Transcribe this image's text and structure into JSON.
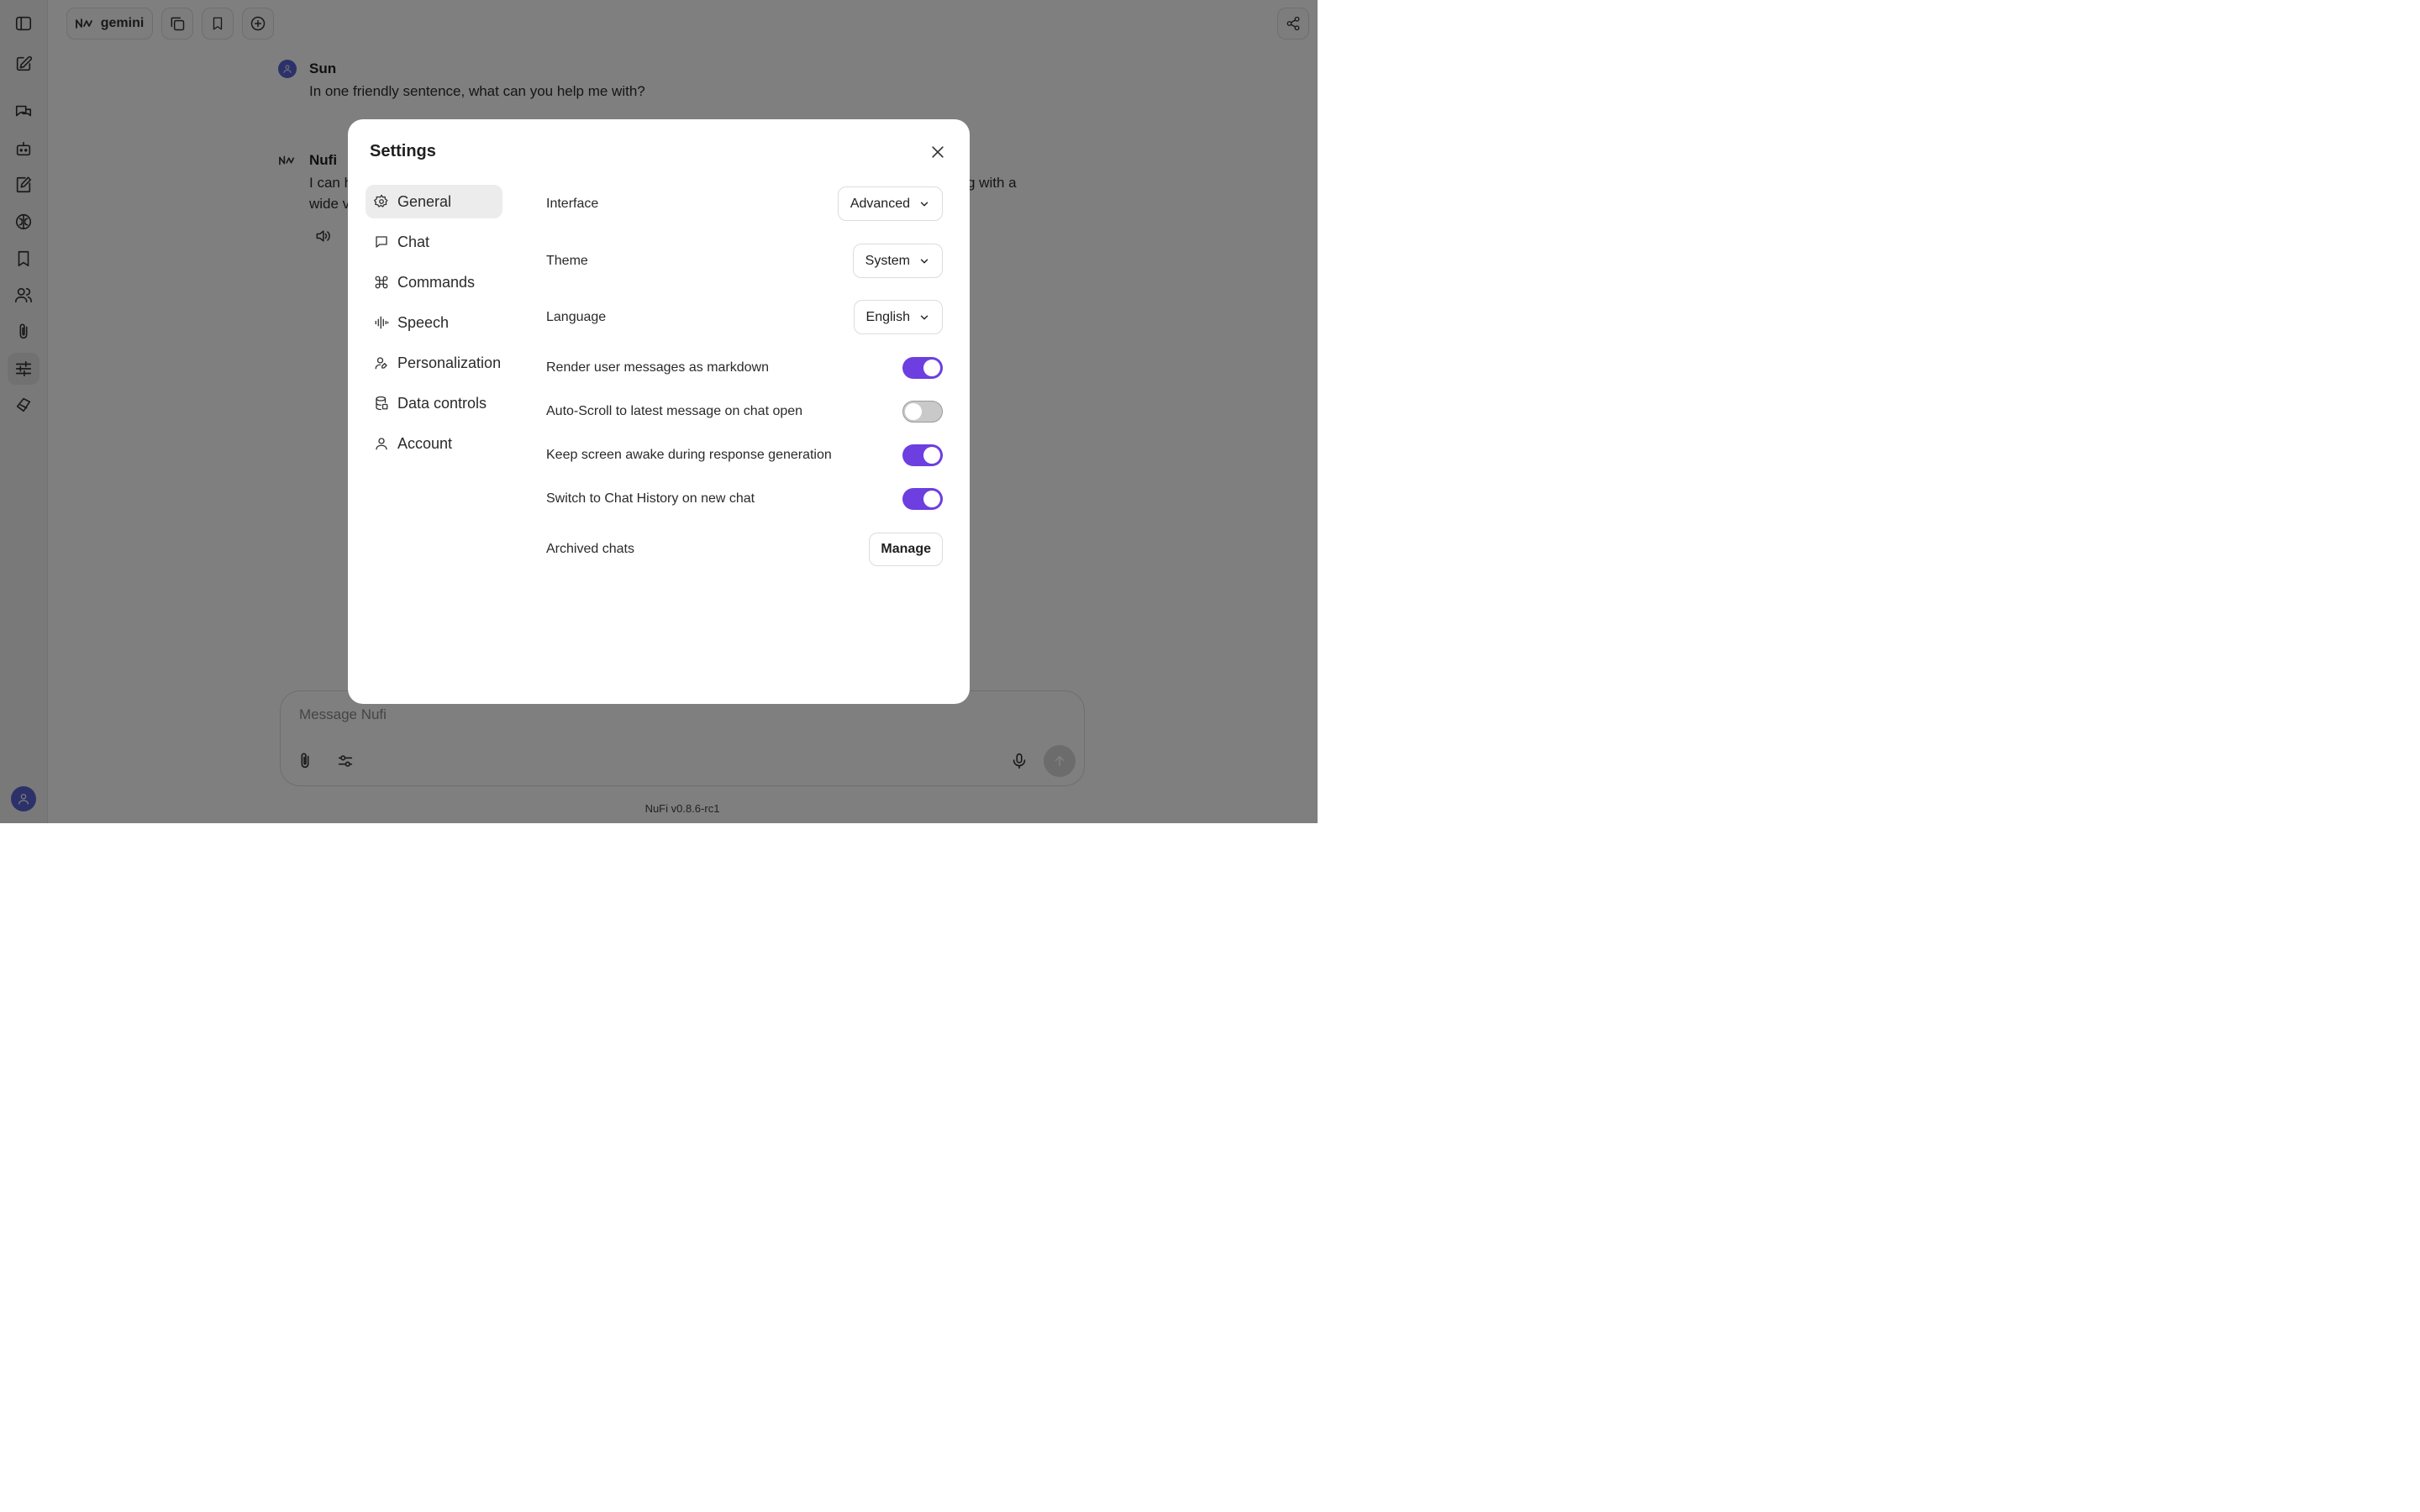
{
  "header": {
    "model_name": "gemini"
  },
  "conversation": {
    "user": {
      "name": "Sun",
      "text": "In one friendly sentence, what can you help me with?"
    },
    "assistant": {
      "name": "Nufi",
      "text_line1": "I can h",
      "text_line1_tail": "g with a",
      "text_line2": "wide v"
    }
  },
  "composer": {
    "placeholder": "Message Nufi"
  },
  "footer": {
    "version": "NuFi v0.8.6-rc1"
  },
  "settings_modal": {
    "title": "Settings",
    "nav": [
      {
        "label": "General",
        "icon": "gear-icon",
        "active": true
      },
      {
        "label": "Chat",
        "icon": "chat-bubble-icon",
        "active": false
      },
      {
        "label": "Commands",
        "icon": "command-icon",
        "active": false
      },
      {
        "label": "Speech",
        "icon": "waveform-icon",
        "active": false
      },
      {
        "label": "Personalization",
        "icon": "user-pen-icon",
        "active": false
      },
      {
        "label": "Data controls",
        "icon": "database-icon",
        "active": false
      },
      {
        "label": "Account",
        "icon": "user-icon",
        "active": false
      }
    ],
    "general": {
      "interface": {
        "label": "Interface",
        "value": "Advanced"
      },
      "theme": {
        "label": "Theme",
        "value": "System"
      },
      "language": {
        "label": "Language",
        "value": "English"
      },
      "toggles": [
        {
          "label": "Render user messages as markdown",
          "on": true
        },
        {
          "label": "Auto-Scroll to latest message on chat open",
          "on": false
        },
        {
          "label": "Keep screen awake during response generation",
          "on": true
        },
        {
          "label": "Switch to Chat History on new chat",
          "on": true
        }
      ],
      "archived": {
        "label": "Archived chats",
        "button": "Manage"
      }
    }
  },
  "colors": {
    "accent": "#6d3ee0",
    "user_avatar": "#5b63d3",
    "overlay": "rgba(0,0,0,0.5)"
  }
}
